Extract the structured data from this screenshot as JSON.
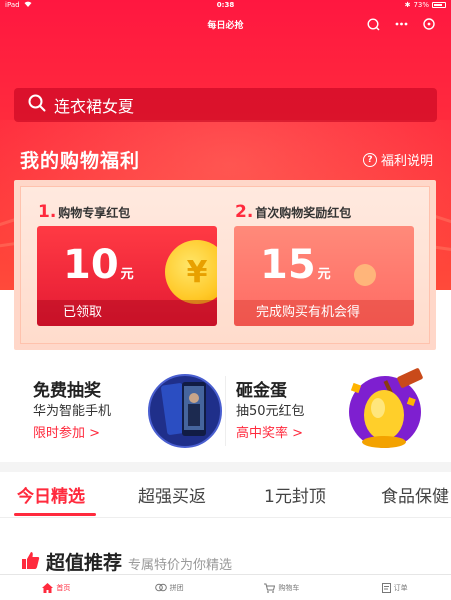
{
  "status_bar": {
    "device": "iPad",
    "time": "0:38",
    "battery": "73%"
  },
  "navbar": {
    "title": "每日必抢"
  },
  "search": {
    "query": "连衣裙女夏"
  },
  "welfare": {
    "title": "我的购物福利",
    "help": "福利说明",
    "coupons": [
      {
        "index": "1.",
        "title": "购物专享红包",
        "amount": "10",
        "unit": "元",
        "footer": "已领取",
        "coin_symbol": "¥"
      },
      {
        "index": "2.",
        "title": "首次购物奖励红包",
        "amount": "15",
        "unit": "元",
        "footer": "完成购买有机会得"
      }
    ]
  },
  "promos": [
    {
      "title": "免费抽奖",
      "subtitle": "华为智能手机",
      "link": "限时参加 >"
    },
    {
      "title": "砸金蛋",
      "subtitle": "抽50元红包",
      "link": "高中奖率 >"
    }
  ],
  "tabs": [
    "今日精选",
    "超强买返",
    "1元封顶",
    "食品保健"
  ],
  "section": {
    "title": "超值推荐",
    "subtitle": "专属特价为你精选"
  },
  "bottom_nav": [
    {
      "label": "首页"
    },
    {
      "label": "拼团"
    },
    {
      "label": "购物车"
    },
    {
      "label": "订单"
    }
  ]
}
